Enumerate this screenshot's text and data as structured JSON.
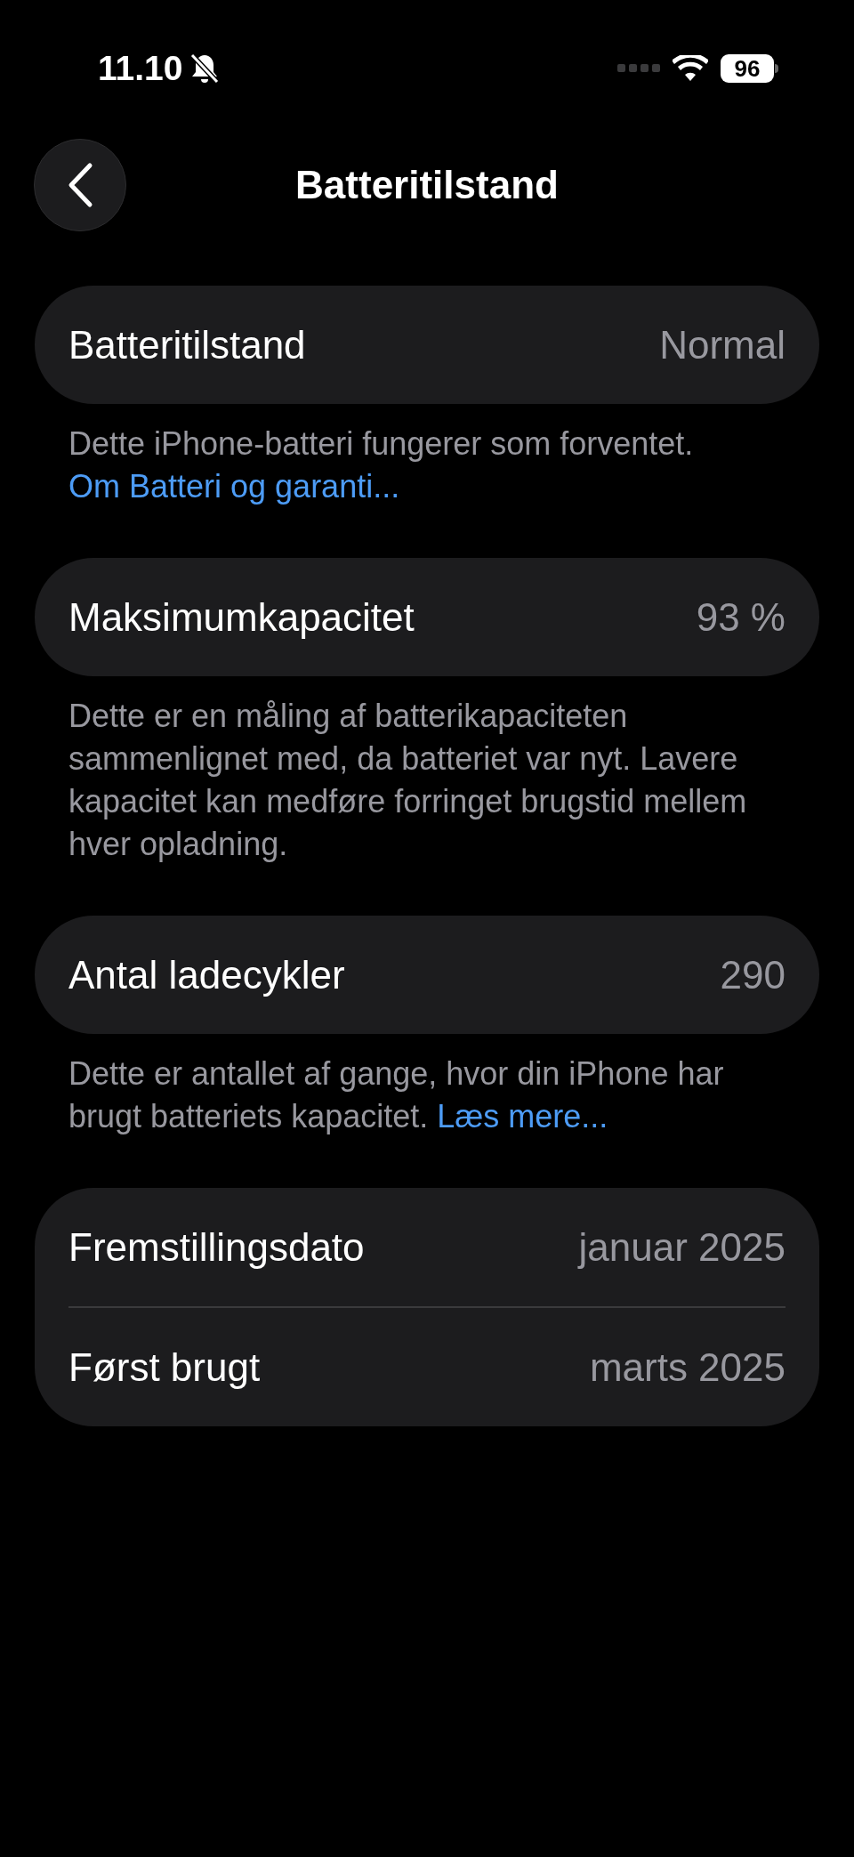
{
  "status_bar": {
    "time": "11.10",
    "silent": true,
    "battery": "96"
  },
  "nav": {
    "title": "Batteritilstand"
  },
  "sections": [
    {
      "rows": [
        {
          "label": "Batteritilstand",
          "value": "Normal"
        }
      ],
      "footnote": {
        "text": "Dette iPhone-batteri fungerer som forventet.",
        "link": "Om Batteri og garanti..."
      }
    },
    {
      "rows": [
        {
          "label": "Maksimumkapacitet",
          "value": "93 %"
        }
      ],
      "footnote": {
        "text": "Dette er en måling af batterikapaciteten sammenlignet med, da batteriet var nyt. Lavere kapacitet kan medføre forringet brugstid mellem hver opladning."
      }
    },
    {
      "rows": [
        {
          "label": "Antal ladecykler",
          "value": "290"
        }
      ],
      "footnote": {
        "text": "Dette er antallet af gange, hvor din iPhone har brugt batteriets kapacitet.",
        "link": "Læs mere..."
      }
    },
    {
      "rows": [
        {
          "label": "Fremstillingsdato",
          "value": "januar 2025"
        },
        {
          "label": "Først brugt",
          "value": "marts 2025"
        }
      ]
    }
  ]
}
